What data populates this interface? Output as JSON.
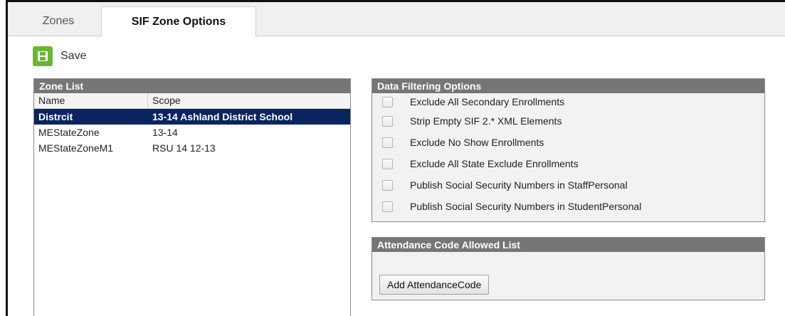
{
  "tabs": {
    "zones": "Zones",
    "sif_zone_options": "SIF Zone Options"
  },
  "toolbar": {
    "save_label": "Save",
    "save_icon": "floppy-disk-icon"
  },
  "zone_list": {
    "title": "Zone List",
    "columns": [
      "Name",
      "Scope"
    ],
    "rows": [
      {
        "name": "Distrcit",
        "scope": "13-14 Ashland District School",
        "selected": true
      },
      {
        "name": "MEStateZone",
        "scope": "13-14",
        "selected": false
      },
      {
        "name": "MEStateZoneM1",
        "scope": "RSU 14 12-13",
        "selected": false
      }
    ]
  },
  "data_filtering": {
    "title": "Data Filtering Options",
    "options": [
      {
        "label": "Exclude All Secondary Enrollments",
        "checked": false
      },
      {
        "label": "Strip Empty SIF 2.* XML Elements",
        "checked": false
      },
      {
        "label": "Exclude No Show Enrollments",
        "checked": false
      },
      {
        "label": "Exclude All State Exclude Enrollments",
        "checked": false
      },
      {
        "label": "Publish Social Security Numbers in StaffPersonal",
        "checked": false
      },
      {
        "label": "Publish Social Security Numbers in StudentPersonal",
        "checked": false
      }
    ]
  },
  "attendance": {
    "title": "Attendance Code Allowed List",
    "add_button": "Add AttendanceCode"
  },
  "colors": {
    "selected_row": "#0b2460",
    "panel_header": "#767676",
    "save_icon": "#6ab632"
  }
}
